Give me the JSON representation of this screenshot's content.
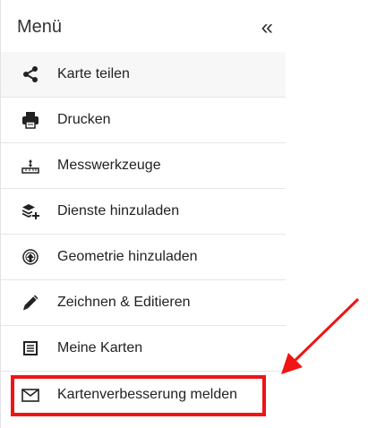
{
  "menu": {
    "title": "Menü",
    "collapse_glyph": "«",
    "items": [
      {
        "label": "Karte teilen",
        "icon": "share-icon"
      },
      {
        "label": "Drucken",
        "icon": "printer-icon"
      },
      {
        "label": "Messwerkzeuge",
        "icon": "ruler-icon"
      },
      {
        "label": "Dienste hinzuladen",
        "icon": "layers-add-icon"
      },
      {
        "label": "Geometrie hinzuladen",
        "icon": "upload-geometry-icon"
      },
      {
        "label": "Zeichnen & Editieren",
        "icon": "pencil-icon"
      },
      {
        "label": "Meine Karten",
        "icon": "list-document-icon"
      },
      {
        "label": "Kartenverbesserung melden",
        "icon": "envelope-icon"
      }
    ]
  },
  "annotation": {
    "color": "#f01414",
    "target": "Kartenverbesserung melden"
  }
}
